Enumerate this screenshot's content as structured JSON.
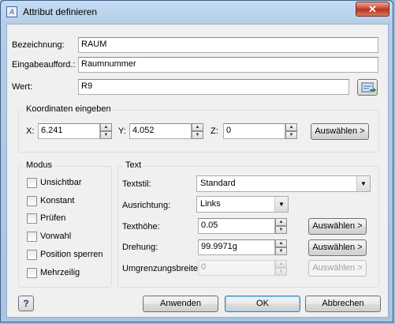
{
  "window": {
    "title": "Attribut definieren",
    "close_label": "✕"
  },
  "fields": {
    "bezeichnung": {
      "label": "Bezeichnung:",
      "value": "RAUM"
    },
    "eingabe": {
      "label": "Eingabeaufford.:",
      "value": "Raumnummer"
    },
    "wert": {
      "label": "Wert:",
      "value": "R9"
    }
  },
  "koordinaten": {
    "title": "Koordinaten eingeben",
    "x_label": "X:",
    "x_value": "6.241",
    "y_label": "Y:",
    "y_value": "4.052",
    "z_label": "Z:",
    "z_value": "0",
    "select_label": "Auswählen >"
  },
  "modus": {
    "title": "Modus",
    "items": [
      "Unsichtbar",
      "Konstant",
      "Prüfen",
      "Vorwahl",
      "Position sperren",
      "Mehrzeilig"
    ]
  },
  "text": {
    "title": "Text",
    "textstil_label": "Textstil:",
    "textstil_value": "Standard",
    "ausrichtung_label": "Ausrichtung:",
    "ausrichtung_value": "Links",
    "texthoehe_label": "Texthöhe:",
    "texthoehe_value": "0.05",
    "drehung_label": "Drehung:",
    "drehung_value": "99.9971g",
    "umgrenzung_label": "Umgrenzungsbreite:",
    "umgrenzung_value": "0",
    "select_label": "Auswählen >"
  },
  "footer": {
    "help_label": "?",
    "apply_label": "Anwenden",
    "ok_label": "OK",
    "cancel_label": "Abbrechen"
  }
}
